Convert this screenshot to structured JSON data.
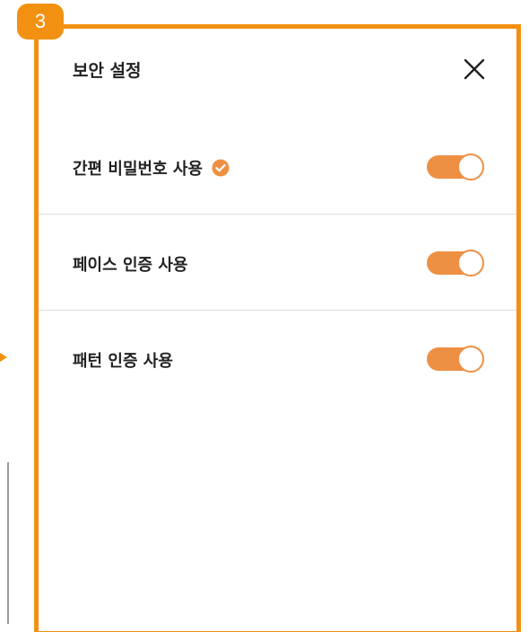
{
  "badge": {
    "step": "3"
  },
  "panel": {
    "title": "보안 설정",
    "close_icon": "close-icon"
  },
  "settings": [
    {
      "label": "간편 비밀번호 사용",
      "verified_icon": "check-circle-icon",
      "enabled": true
    },
    {
      "label": "페이스 인증 사용",
      "enabled": true
    },
    {
      "label": "패턴 인증 사용",
      "enabled": true
    }
  ],
  "colors": {
    "highlight": "#F29111",
    "toggle_on": "#EE9043",
    "text": "#222222",
    "divider": "#dedede"
  }
}
